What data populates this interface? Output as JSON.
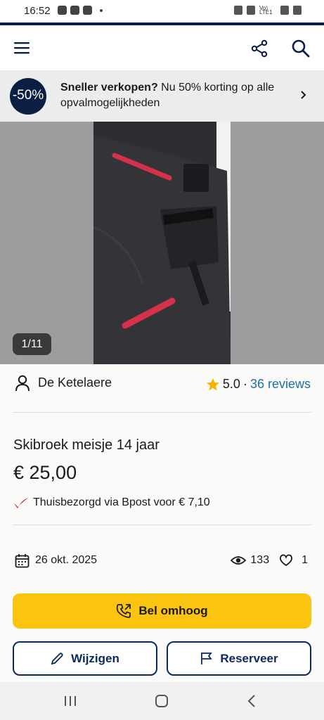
{
  "status_bar": {
    "time": "16:52",
    "network": "Vo) LTE1"
  },
  "promo": {
    "badge": "-50%",
    "bold": "Sneller verkopen?",
    "text": " Nu 50% korting op alle opvalmogelijkheden"
  },
  "gallery": {
    "counter": "1/11"
  },
  "seller": {
    "name": "De Ketelaere",
    "rating": "5.0",
    "separator": "·",
    "reviews": "36 reviews"
  },
  "listing": {
    "title": "Skibroek meisje 14 jaar",
    "price": "€ 25,00",
    "delivery": "Thuisbezorgd via Bpost voor € 7,10",
    "date": "26 okt. 2025",
    "views": "133",
    "likes": "1"
  },
  "actions": {
    "call": "Bel omhoog",
    "edit": "Wijzigen",
    "reserve": "Reserveer"
  },
  "colors": {
    "navy": "#0b1f44",
    "accent": "#fbc410",
    "link": "#1d6fa5",
    "star": "#f5b400"
  },
  "icons": [
    "menu-icon",
    "share-icon",
    "search-icon",
    "chevron-right-icon",
    "user-icon",
    "star-icon",
    "delivery-check-icon",
    "calendar-icon",
    "eye-icon",
    "heart-icon",
    "phone-icon",
    "pencil-icon",
    "flag-icon"
  ]
}
